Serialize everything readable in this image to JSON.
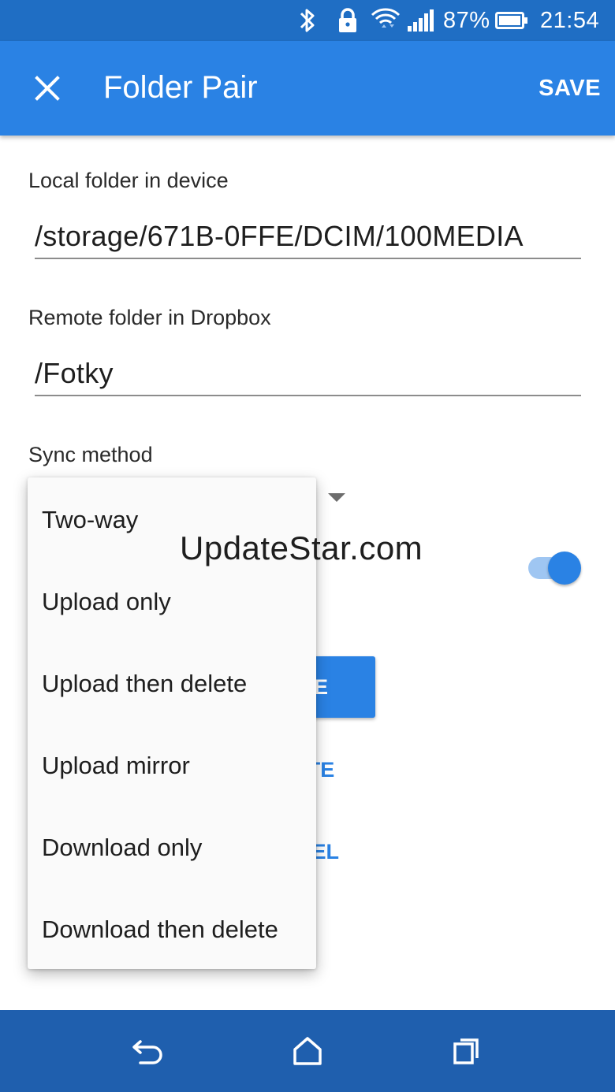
{
  "status_bar": {
    "battery_percent": "87%",
    "time": "21:54",
    "icons": [
      "bluetooth-icon",
      "lock-icon",
      "wifi-icon",
      "signal-icon",
      "battery-icon"
    ]
  },
  "app_bar": {
    "close_icon": "close-icon",
    "title": "Folder Pair",
    "save_label": "SAVE"
  },
  "form": {
    "local_folder": {
      "label": "Local folder in device",
      "value": "/storage/671B-0FFE/DCIM/100MEDIA"
    },
    "remote_folder": {
      "label": "Remote folder in Dropbox",
      "value": "/Fotky"
    },
    "sync_method": {
      "label": "Sync method",
      "toggle_on": true
    }
  },
  "buttons": {
    "save_partial": "VE",
    "delete_partial": "ETE",
    "cancel_partial": "CEL"
  },
  "dropdown": {
    "options": [
      "Two-way",
      "Upload only",
      "Upload then delete",
      "Upload mirror",
      "Download only",
      "Download then delete"
    ]
  },
  "watermark": "UpdateStar.com",
  "nav_bar": {
    "icons": [
      "back-icon",
      "home-icon",
      "recents-icon"
    ]
  },
  "colors": {
    "status_bar": "#1f6ec4",
    "app_bar": "#2a82e4",
    "nav_bar": "#1f5fae",
    "accent": "#2a82e4"
  }
}
